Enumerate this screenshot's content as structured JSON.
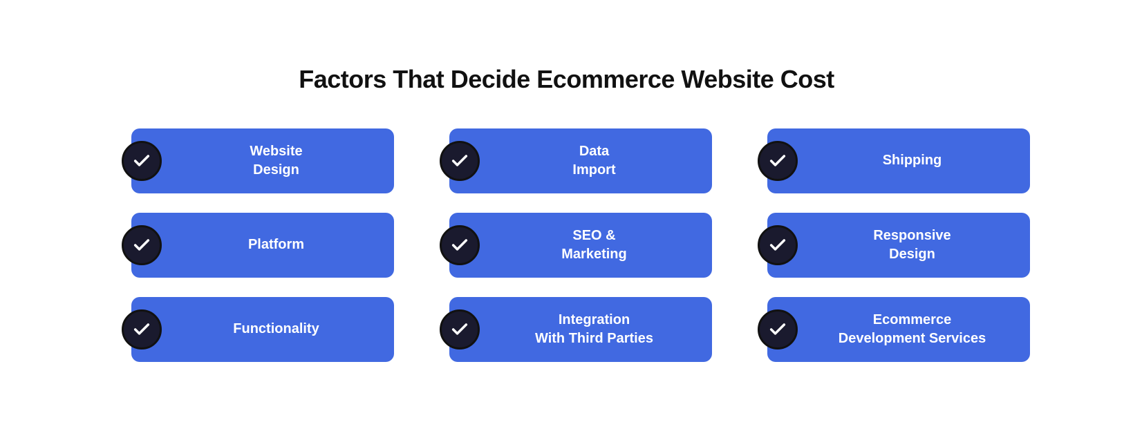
{
  "page": {
    "title": "Factors That Decide Ecommerce Website Cost"
  },
  "cards": [
    {
      "id": "website-design",
      "label": "Website\nDesign"
    },
    {
      "id": "data-import",
      "label": "Data\nImport"
    },
    {
      "id": "shipping",
      "label": "Shipping"
    },
    {
      "id": "platform",
      "label": "Platform"
    },
    {
      "id": "seo-marketing",
      "label": "SEO &\nMarketing"
    },
    {
      "id": "responsive-design",
      "label": "Responsive\nDesign"
    },
    {
      "id": "functionality",
      "label": "Functionality"
    },
    {
      "id": "integration-third-parties",
      "label": "Integration\nWith Third Parties"
    },
    {
      "id": "ecommerce-development",
      "label": "Ecommerce\nDevelopment Services"
    }
  ],
  "colors": {
    "card_bg": "#4169e1",
    "circle_bg": "#1a1a1a",
    "text": "#ffffff",
    "title": "#111111"
  }
}
